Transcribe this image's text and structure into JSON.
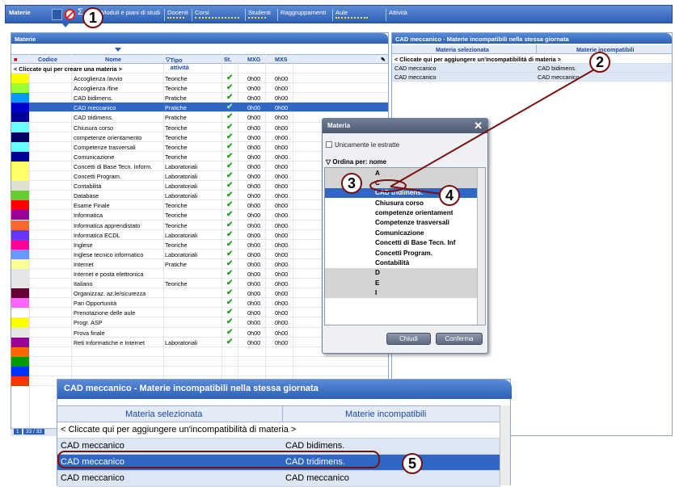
{
  "topbar": {
    "tabs": [
      "Materie",
      "Moduli e piani di studi",
      "Docenti",
      "Corsi",
      "Studenti",
      "Raggruppamenti",
      "Aule",
      "Attività"
    ]
  },
  "callouts": [
    "1",
    "2",
    "3",
    "4",
    "5"
  ],
  "left_panel": {
    "title": "Materie",
    "columns": [
      "Codice",
      "Nome",
      "Tipo attività",
      "St.",
      "MXG",
      "MXS"
    ],
    "create_row": "< Cliccate qui per creare una materia >",
    "rows": [
      {
        "color": "#ffff00",
        "name": "Accoglienza /avvio",
        "type": "Teoriche",
        "mxg": "0h00",
        "mxs": "0h00"
      },
      {
        "color": "#99ff33",
        "name": "Accoglienza /fine",
        "type": "Teoriche",
        "mxg": "0h00",
        "mxs": "0h00"
      },
      {
        "color": "#0099ff",
        "name": "CAD bidimens.",
        "type": "Pratiche",
        "mxg": "0h00",
        "mxs": "0h00"
      },
      {
        "color": "#0000cc",
        "name": "CAD meccanico",
        "type": "Pratiche",
        "mxg": "0h00",
        "mxs": "0h00",
        "selected": true
      },
      {
        "color": "#000099",
        "name": "CAD tridimens.",
        "type": "Pratiche",
        "mxg": "0h00",
        "mxs": "0h00"
      },
      {
        "color": "#66ffff",
        "name": "Chiusura corso",
        "type": "Teoriche",
        "mxg": "0h00",
        "mxs": "0h00"
      },
      {
        "color": "#000066",
        "name": "competenze orientamento",
        "type": "Teoriche",
        "mxg": "0h00",
        "mxs": "0h00"
      },
      {
        "color": "#66ffff",
        "name": "Competenze trasversali",
        "type": "Teoriche",
        "mxg": "0h00",
        "mxs": "0h00"
      },
      {
        "color": "#000099",
        "name": "Comunicazione",
        "type": "Teoriche",
        "mxg": "0h00",
        "mxs": "0h00"
      },
      {
        "color": "#ffff66",
        "name": "Concetti di Base Tecn. Inform.",
        "type": "Laboratoriali",
        "mxg": "0h00",
        "mxs": "0h00"
      },
      {
        "color": "#ffff66",
        "name": "Concetti Program.",
        "type": "Laboratoriali",
        "mxg": "0h00",
        "mxs": "0h00"
      },
      {
        "color": "#e0e0d0",
        "name": "Contabilità",
        "type": "Laboratoriali",
        "mxg": "0h00",
        "mxs": "0h00"
      },
      {
        "color": "#66cc33",
        "name": "Database",
        "type": "Laboratoriali",
        "mxg": "0h00",
        "mxs": "0h00"
      },
      {
        "color": "#ff0000",
        "name": "Esame Finale",
        "type": "Teoriche",
        "mxg": "0h00",
        "mxs": "0h00"
      },
      {
        "color": "#990099",
        "name": "Informatica",
        "type": "Teoriche",
        "mxg": "0h00",
        "mxs": "0h00"
      },
      {
        "color": "#ff6633",
        "name": "Informatica apprendistato",
        "type": "Teoriche",
        "mxg": "0h00",
        "mxs": "0h00"
      },
      {
        "color": "#6633ff",
        "name": "Informatica ECDL",
        "type": "Laboratoriali",
        "mxg": "0h00",
        "mxs": "0h00"
      },
      {
        "color": "#ff0099",
        "name": "Inglese",
        "type": "Teoriche",
        "mxg": "0h00",
        "mxs": "0h00"
      },
      {
        "color": "#6699ff",
        "name": "Inglese tecnico informatico",
        "type": "Laboratoriali",
        "mxg": "0h00",
        "mxs": "0h00"
      },
      {
        "color": "#ffff99",
        "name": "Internet",
        "type": "Pratiche",
        "mxg": "0h00",
        "mxs": "0h00"
      },
      {
        "color": "#e6e6e6",
        "name": "Internet e posta elettronica",
        "type": "",
        "mxg": "0h00",
        "mxs": "0h00"
      },
      {
        "color": "#e6e6e6",
        "name": "Italiano",
        "type": "Teoriche",
        "mxg": "0h00",
        "mxs": "0h00"
      },
      {
        "color": "#660033",
        "name": "Organizzaz. az.le/sicurezza",
        "type": "",
        "mxg": "0h00",
        "mxs": "0h00"
      },
      {
        "color": "#ff66ff",
        "name": "Pari Opportunità",
        "type": "",
        "mxg": "0h00",
        "mxs": "0h00"
      },
      {
        "color": "#ffffff",
        "name": "Prenotazione delle aule",
        "type": "",
        "mxg": "0h00",
        "mxs": "0h00"
      },
      {
        "color": "#ffff00",
        "name": "Progr. ASP",
        "type": "",
        "mxg": "0h00",
        "mxs": "0h00"
      },
      {
        "color": "#e6e6e6",
        "name": "Prova finale",
        "type": "",
        "mxg": "0h00",
        "mxs": "0h00"
      },
      {
        "color": "#990099",
        "name": "Reti Informatiche e Internet",
        "type": "Laboratoriali",
        "mxg": "0h00",
        "mxs": "0h00"
      },
      {
        "color": "#ff6600",
        "name": "",
        "type": "",
        "mxg": "",
        "mxs": ""
      },
      {
        "color": "#009900",
        "name": "",
        "type": "",
        "mxg": "",
        "mxs": ""
      },
      {
        "color": "#0033ff",
        "name": "",
        "type": "",
        "mxg": "",
        "mxs": ""
      },
      {
        "color": "#ff3300",
        "name": "",
        "type": "",
        "mxg": "",
        "mxs": ""
      }
    ],
    "status": "33 / 33"
  },
  "right_panel": {
    "title": "CAD meccanico - Materie incompatibili nella stessa giornata",
    "col_selected": "Materia selezionata",
    "col_incompatible": "Materie incompatibili",
    "add_row": "< Cliccate qui per aggiungere un'incompatibilità di materia >",
    "rows": [
      {
        "selected": "CAD meccanico",
        "incompatible": "CAD bidimens."
      },
      {
        "selected": "CAD meccanico",
        "incompatible": "CAD meccanico"
      }
    ]
  },
  "dialog": {
    "title": "Materia",
    "checkbox_label": "Unicamente le estratte",
    "sort_label": "Ordina per: nome",
    "items": [
      {
        "label": "A",
        "group": true
      },
      {
        "label": "C",
        "group": true
      },
      {
        "label": "CAD tridimens.",
        "selected": true
      },
      {
        "label": "Chiusura corso"
      },
      {
        "label": "competenze orientament"
      },
      {
        "label": "Competenze trasversali"
      },
      {
        "label": "Comunicazione"
      },
      {
        "label": "Concetti di Base Tecn. Inf"
      },
      {
        "label": "Concetti Program."
      },
      {
        "label": "Contabilità"
      },
      {
        "label": "D",
        "group": true
      },
      {
        "label": "E",
        "group": true
      },
      {
        "label": "I",
        "group": true
      }
    ],
    "cancel_label": "Chiudi",
    "confirm_label": "Conferma"
  },
  "zoom": {
    "title": "CAD meccanico - Materie incompatibili nella stessa giornata",
    "col_selected": "Materia selezionata",
    "col_incompatible": "Materie incompatibili",
    "add_row": "< Cliccate qui per aggiungere un'incompatibilità di materia >",
    "rows": [
      {
        "selected": "CAD meccanico",
        "incompatible": "CAD bidimens."
      },
      {
        "selected": "CAD meccanico",
        "incompatible": "CAD tridimens.",
        "highlighted": true
      },
      {
        "selected": "CAD meccanico",
        "incompatible": "CAD meccanico"
      }
    ]
  }
}
